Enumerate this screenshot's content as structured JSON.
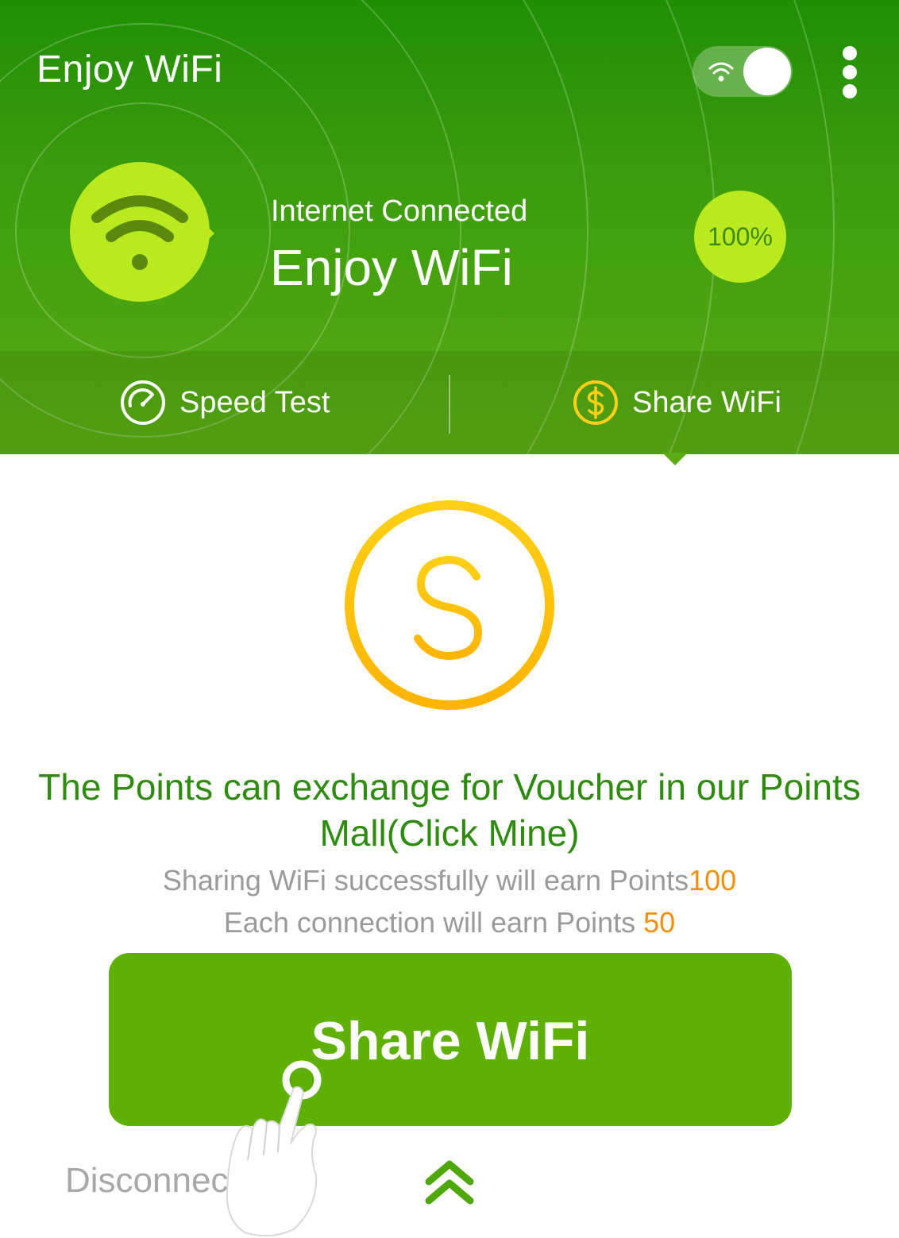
{
  "header": {
    "app_title": "Enjoy WiFi",
    "status": "Internet Connected",
    "network_name": "Enjoy WiFi",
    "signal_strength": "100%",
    "wifi_toggle_on": true
  },
  "tabs": [
    {
      "label": "Speed Test",
      "icon": "speedometer-icon",
      "active": false
    },
    {
      "label": "Share WiFi",
      "icon": "dollar-coin-icon",
      "active": true
    }
  ],
  "content": {
    "headline": "The Points can exchange for Voucher in our Points Mall(Click Mine)",
    "share_reward_text": "Sharing WiFi successfully will earn Points",
    "share_reward_points": "100",
    "connection_reward_text": "Each connection will earn Points ",
    "connection_reward_points": "50",
    "share_button_label": "Share WiFi",
    "disconnect_label": "Disconnect"
  },
  "colors": {
    "header_green": "#208e05",
    "button_green": "#5fb004",
    "badge_lime": "#b9e91f",
    "headline_green": "#2e8b10",
    "points_orange": "#f0900c",
    "coin_gold": "#ffc30f"
  },
  "icons": {
    "menu": "more-vertical-icon",
    "toggle": "wifi-icon",
    "badge": "wifi-icon",
    "coin": "dollar-coin-icon",
    "expand": "chevron-double-up-icon",
    "hint": "tap-hand-icon"
  }
}
